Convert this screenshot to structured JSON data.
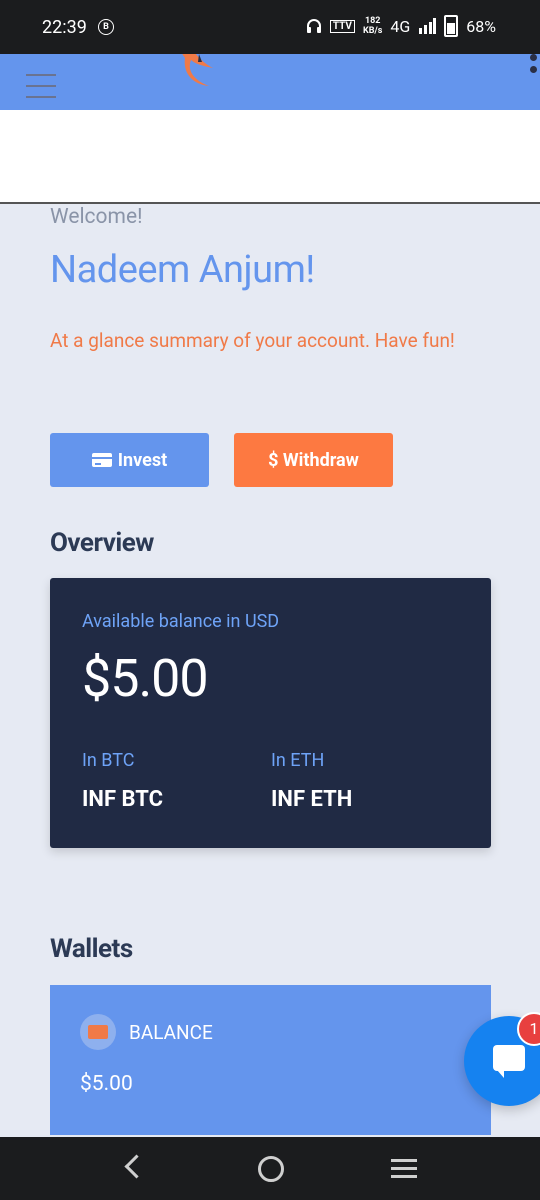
{
  "status_bar": {
    "time": "22:39",
    "b_icon": "B",
    "ttv": "TTV",
    "speed_value": "182",
    "speed_unit": "KB/s",
    "network": "4G",
    "battery": "68%"
  },
  "header": {
    "menu_icon": "hamburger-icon",
    "logo_icon": "bird-logo",
    "overflow_icon": "more-vert-icon"
  },
  "greeting": {
    "welcome": "Welcome!",
    "name": "Nadeem Anjum!",
    "summary": "At a glance summary of your account. Have fun!"
  },
  "actions": {
    "invest_label": "Invest",
    "withdraw_label": "$ Withdraw"
  },
  "overview": {
    "heading": "Overview",
    "balance_label": "Available balance in USD",
    "balance_value": "$5.00",
    "btc_label": "In BTC",
    "btc_value": "INF BTC",
    "eth_label": "In ETH",
    "eth_value": "INF ETH"
  },
  "wallets": {
    "heading": "Wallets",
    "items": [
      {
        "label": "BALANCE",
        "amount": "$5.00",
        "icon": "wallet-icon"
      }
    ]
  },
  "chat": {
    "badge_count": "1",
    "icon": "chat-bubble-icon"
  },
  "colors": {
    "primary": "#6495ed",
    "accent": "#fd7941",
    "card_dark": "#202a44",
    "background": "#e6eaf3"
  }
}
